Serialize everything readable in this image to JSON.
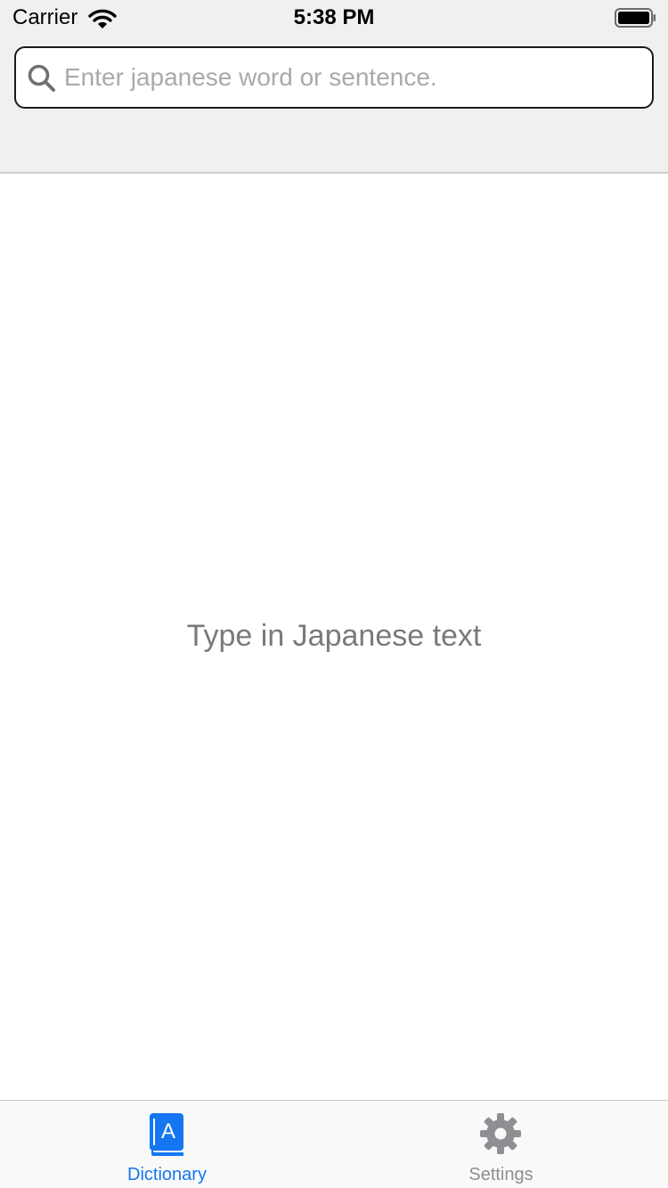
{
  "status_bar": {
    "carrier": "Carrier",
    "time": "5:38 PM",
    "wifi_icon": "wifi-icon",
    "battery_icon": "battery-full-icon"
  },
  "search": {
    "placeholder": "Enter japanese word or sentence.",
    "value": "",
    "icon": "search-icon"
  },
  "main": {
    "empty_message": "Type in Japanese text"
  },
  "tab_bar": {
    "tabs": [
      {
        "label": "Dictionary",
        "icon": "dictionary-book-icon",
        "selected": true
      },
      {
        "label": "Settings",
        "icon": "gear-icon",
        "selected": false
      }
    ]
  },
  "colors": {
    "accent": "#1476f0",
    "inactive": "#8e8e93",
    "header_background": "#f0f0f0",
    "placeholder": "#a9a9ae",
    "empty_message": "#7a7a7a"
  }
}
